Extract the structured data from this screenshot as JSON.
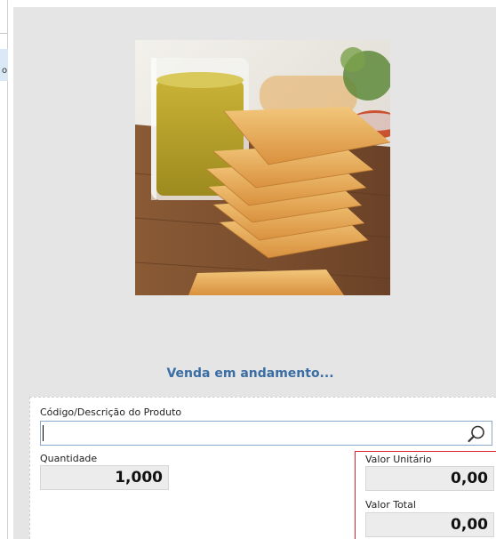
{
  "sidebar": {
    "fragment_text": "o"
  },
  "status": {
    "text": "Venda em andamento..."
  },
  "product": {
    "image_name": "pastel-and-juice-photo"
  },
  "form": {
    "product_label": "Código/Descrição do Produto",
    "product_value": "",
    "quantity_label": "Quantidade",
    "quantity_value": "1,000",
    "unit_price_label": "Valor Unitário",
    "unit_price_value": "0,00",
    "total_label": "Valor Total",
    "total_value": "0,00"
  },
  "colors": {
    "status_text": "#3a6da3",
    "highlight_frame": "#d9232f",
    "panel_bg": "#e5e5e5",
    "input_border": "#8aa9c8"
  },
  "icons": {
    "search": "magnifier-icon"
  }
}
